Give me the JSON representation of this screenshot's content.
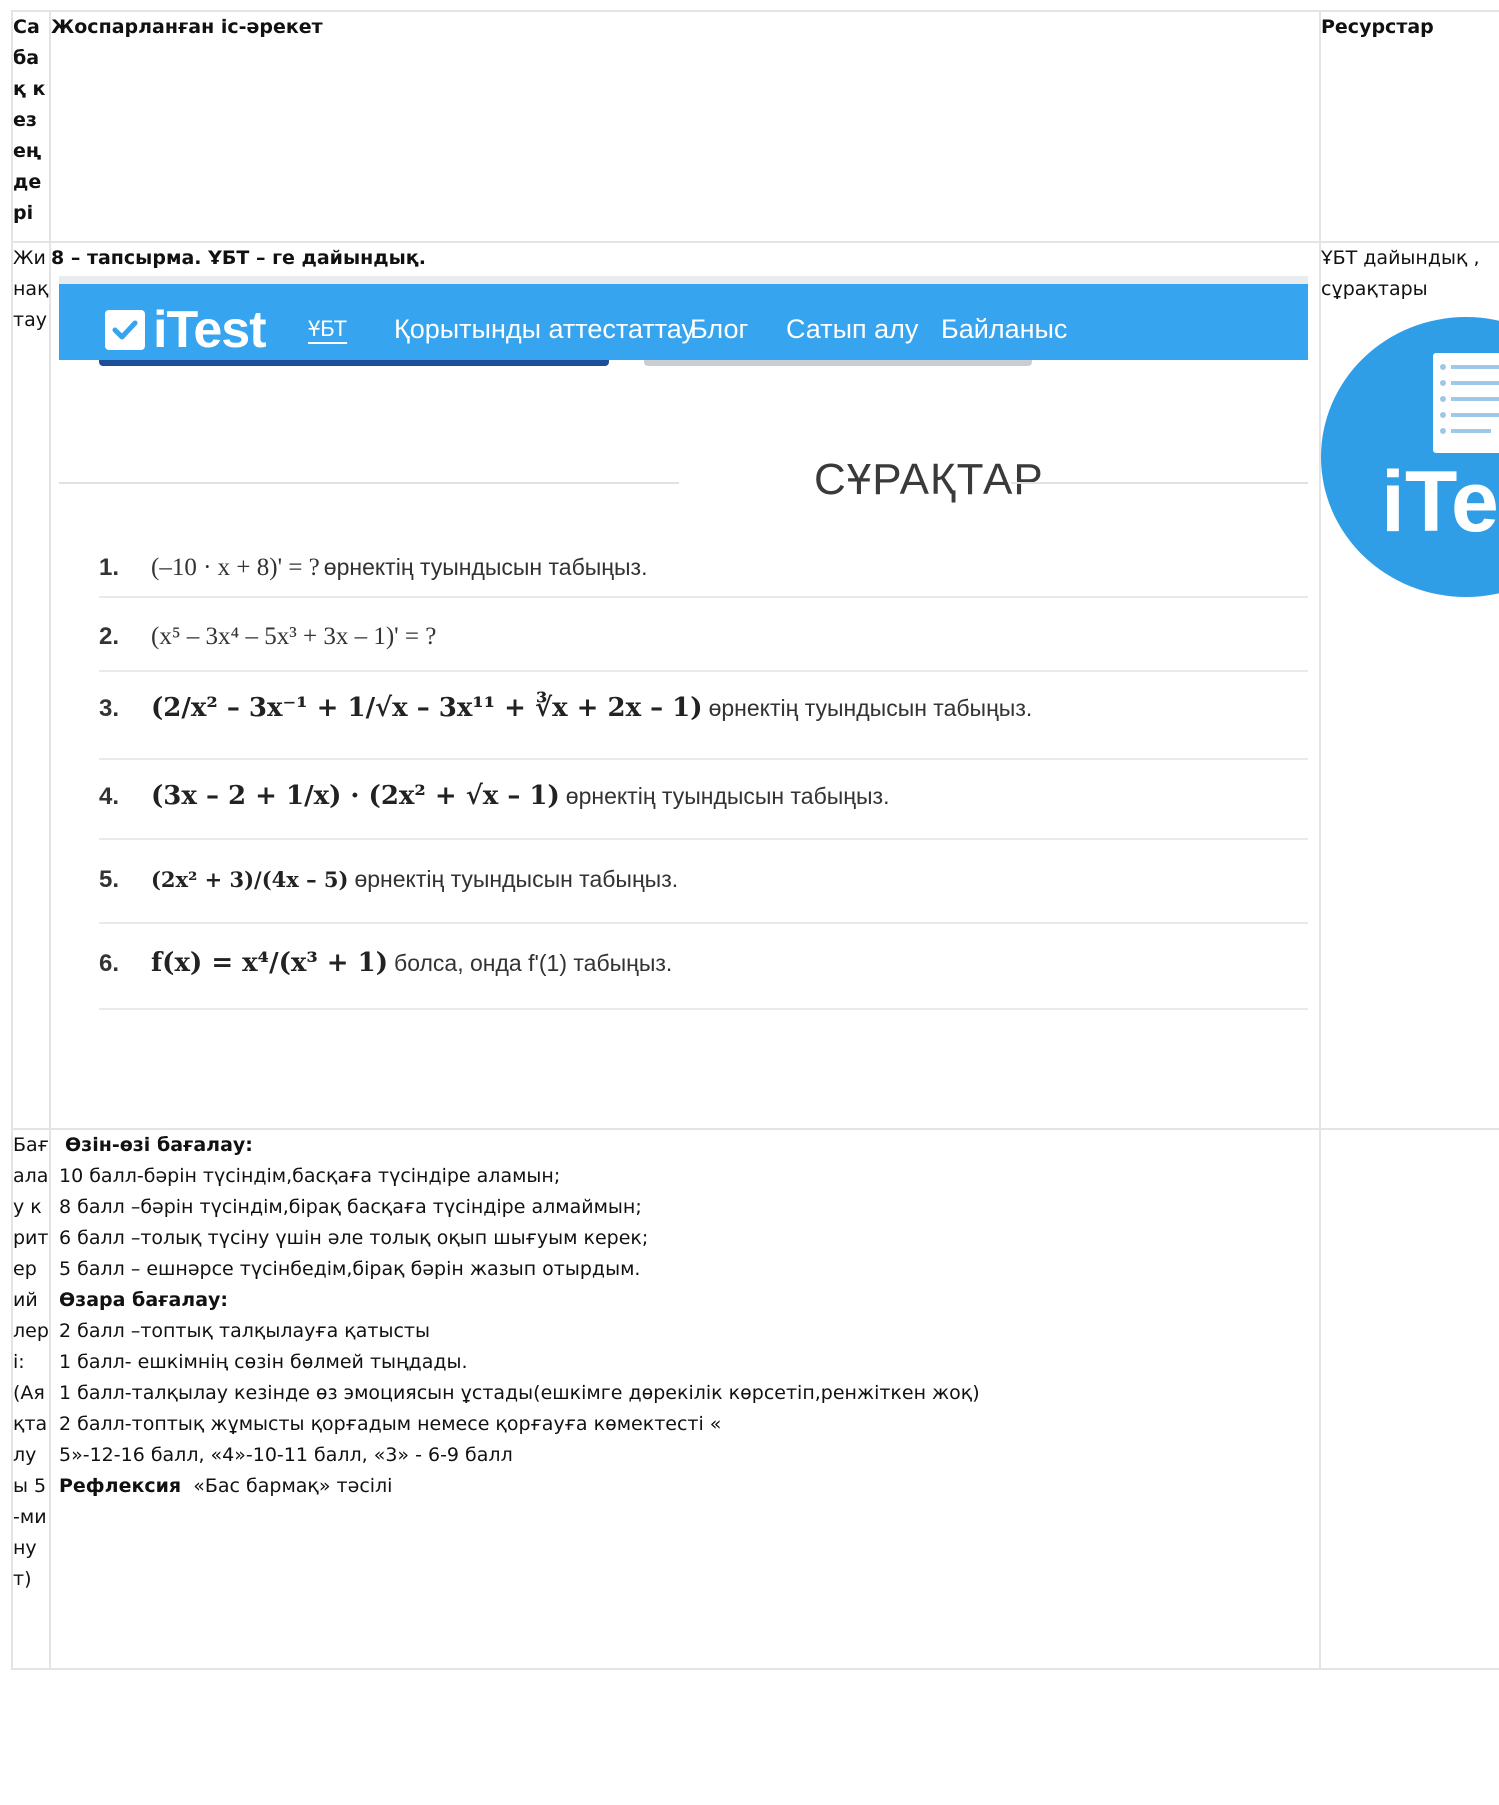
{
  "header": {
    "stage": "Сабақ кезеңдері",
    "planned": "Жоспарланған іс-әрекет",
    "resources": "Ресурстар"
  },
  "row1": {
    "stage": "Жинақтау",
    "task": "8 – тапсырма. ҰБТ – ге дайындық.",
    "resource_text": "ҰБТ дайындық , сұрақтары",
    "screenshot": {
      "logo": "iTest",
      "nav": [
        "ҰБТ",
        "Қорытынды аттестаттау",
        "Блог",
        "Сатып алу",
        "Байланыс"
      ],
      "heading": "СҰРАҚТАР",
      "questions": [
        {
          "n": "1.",
          "math": "(–10 · x + 8)' = ?",
          "text": "өрнектің туындысын табыңыз."
        },
        {
          "n": "2.",
          "math": "(x⁵ – 3x⁴ – 5x³ + 3x – 1)' = ?",
          "text": ""
        },
        {
          "n": "3.",
          "math": "(2/x² – 3x⁻¹ + 1/√x – 3x¹¹ + ∛x + 2x – 1)",
          "text": "өрнектің туындысын табыңыз."
        },
        {
          "n": "4.",
          "math": "(3x – 2 + 1/x) · (2x² + √x – 1)",
          "text": "өрнектің туындысын табыңыз."
        },
        {
          "n": "5.",
          "math": "(2x² + 3)/(4x – 5)",
          "text": "өрнектің туындысын табыңыз."
        },
        {
          "n": "6.",
          "math": "f(x) = x⁴/(x³ + 1)",
          "text": "болса, онда f'(1) табыңыз."
        }
      ]
    },
    "resource_logo": "iTest"
  },
  "row2": {
    "stage": "Бағалау критерийлері: (Аяқталуы 5-минут)",
    "self_title": "Өзін-өзі бағалау:",
    "self_items": [
      "10 балл-бәрін түсіндім,басқаға түсіндіре аламын;",
      "8 балл –бәрін түсіндім,бірақ басқаға түсіндіре алмаймын;",
      "6 балл –толық түсіну үшін әле толық оқып шығуым керек;",
      "5 балл – ешнәрсе түсінбедім,бірақ бәрін жазып отырдым."
    ],
    "peer_title": "Өзара бағалау:",
    "peer_items": [
      "2 балл –топтық талқылауға қатысты",
      "1 балл- ешкімнің сөзін бөлмей тыңдады.",
      "1 балл-талқылау кезінде өз эмоциясын ұстады(ешкімге дөрекілік көрсетіп,ренжіткен жоқ)",
      "2 балл-топтық жұмысты қорғадым немесе қорғауға көмектесті «",
      "5»-12-16 балл, «4»-10-11 балл, «3» - 6-9 балл"
    ],
    "reflection_title": "Рефлексия",
    "reflection_text": "«Бас бармақ» тәсілі"
  }
}
